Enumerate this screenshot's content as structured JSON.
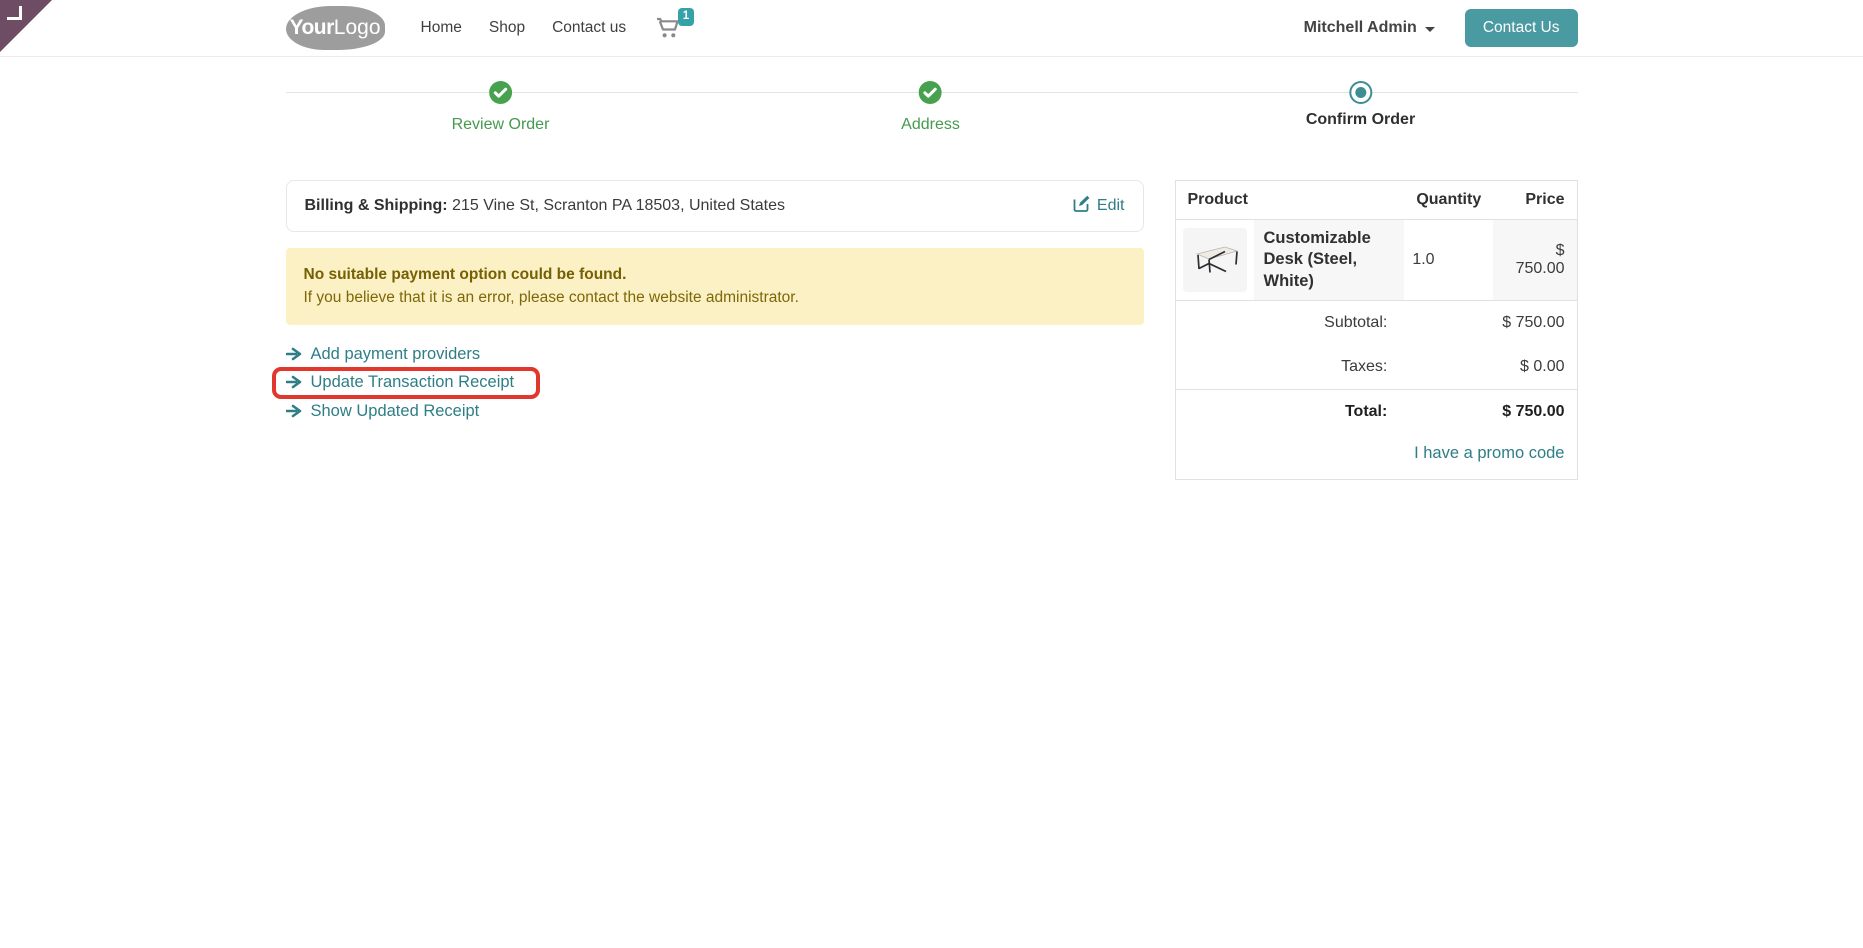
{
  "header": {
    "logo": {
      "part1": "Your",
      "part2": "Logo"
    },
    "nav": [
      {
        "label": "Home"
      },
      {
        "label": "Shop"
      },
      {
        "label": "Contact us"
      }
    ],
    "cart": {
      "count": "1"
    },
    "user_menu": {
      "label": "Mitchell Admin"
    },
    "contact_button": "Contact Us"
  },
  "steps": [
    {
      "label": "Review Order",
      "state": "done"
    },
    {
      "label": "Address",
      "state": "done"
    },
    {
      "label": "Confirm Order",
      "state": "current"
    }
  ],
  "billing": {
    "label": "Billing & Shipping:",
    "address": "215 Vine St, Scranton PA 18503, United States",
    "edit_label": "Edit"
  },
  "alert": {
    "title": "No suitable payment option could be found.",
    "message": "If you believe that it is an error, please contact the website administrator."
  },
  "actions": [
    {
      "label": "Add payment providers",
      "highlighted": false
    },
    {
      "label": "Update Transaction Receipt",
      "highlighted": true
    },
    {
      "label": "Show Updated Receipt",
      "highlighted": false
    }
  ],
  "order": {
    "columns": {
      "product": "Product",
      "quantity": "Quantity",
      "price": "Price"
    },
    "items": [
      {
        "name": "Customizable Desk (Steel, White)",
        "quantity": "1.0",
        "price": "$ 750.00"
      }
    ],
    "subtotal_label": "Subtotal:",
    "subtotal": "$ 750.00",
    "taxes_label": "Taxes:",
    "taxes": "$ 0.00",
    "total_label": "Total:",
    "total": "$ 750.00",
    "promo_link": "I have a promo code"
  },
  "colors": {
    "accent_teal": "#3e8d95",
    "success_green": "#47a14e",
    "brand_purple": "#6e4c63",
    "highlight_red": "#e1372d",
    "warning_bg": "#fcf1c5",
    "warning_text": "#7d6708"
  }
}
